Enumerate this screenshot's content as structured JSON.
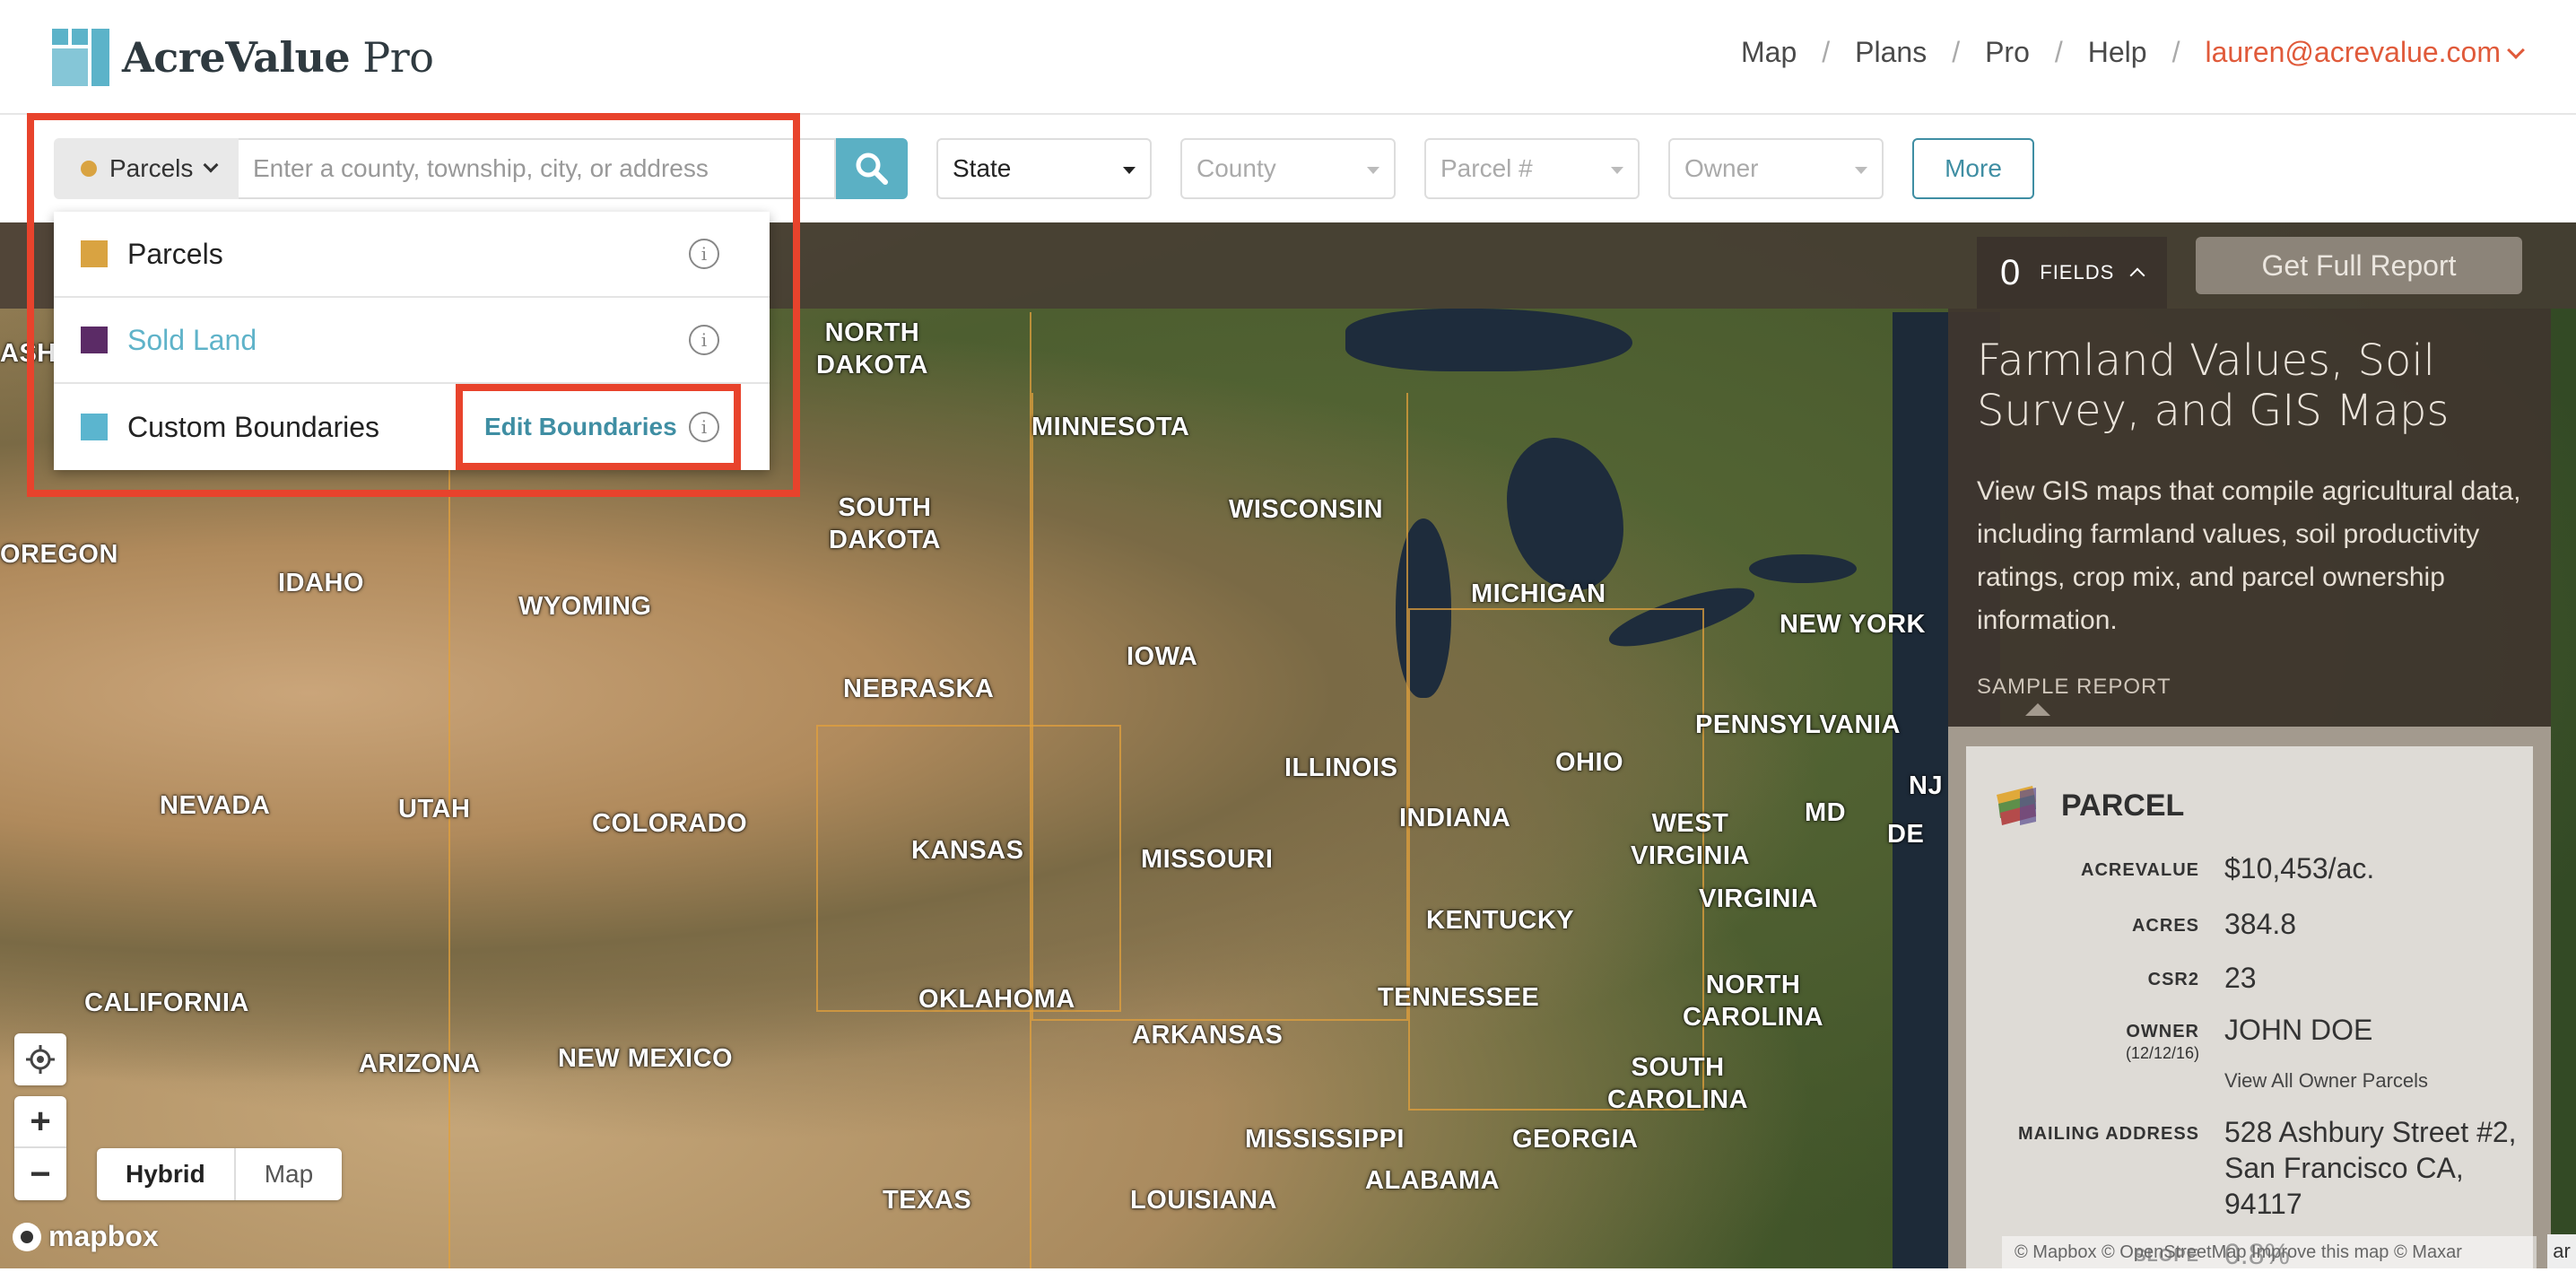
{
  "header": {
    "logo_bold": "AcreValue",
    "logo_light": "Pro",
    "nav": [
      "Map",
      "Plans",
      "Pro",
      "Help"
    ],
    "user_email": "lauren@acrevalue.com"
  },
  "filters": {
    "layer_label": "Parcels",
    "layer_dot_color": "#d9a341",
    "search_placeholder": "Enter a county, township, city, or address",
    "state_label": "State",
    "county_placeholder": "County",
    "parcel_placeholder": "Parcel #",
    "owner_placeholder": "Owner",
    "more_label": "More"
  },
  "layer_menu": {
    "items": [
      {
        "label": "Parcels",
        "color": "#d9a341"
      },
      {
        "label": "Sold Land",
        "color": "#5b2b66"
      },
      {
        "label": "Custom Boundaries",
        "color": "#5bb5cf"
      }
    ],
    "edit_label": "Edit Boundaries",
    "info_glyph": "i"
  },
  "map": {
    "state_labels": {
      "north_dakota": "NORTH\nDAKOTA",
      "minnesota": "MINNESOTA",
      "south_dakota": "SOUTH\nDAKOTA",
      "wisconsin": "WISCONSIN",
      "oregon": "OREGON",
      "idaho": "IDAHO",
      "wyoming": "WYOMING",
      "michigan": "MICHIGAN",
      "new_york": "NEW YORK",
      "iowa": "IOWA",
      "nebraska": "NEBRASKA",
      "pennsylvania": "PENNSYLVANIA",
      "illinois": "ILLINOIS",
      "ohio": "OHIO",
      "nevada": "NEVADA",
      "utah": "UTAH",
      "colorado": "COLORADO",
      "indiana": "INDIANA",
      "md": "MD",
      "nj": "NJ",
      "de": "DE",
      "kansas": "KANSAS",
      "missouri": "MISSOURI",
      "west_virginia": "WEST\nVIRGINIA",
      "virginia": "VIRGINIA",
      "kentucky": "KENTUCKY",
      "california": "CALIFORNIA",
      "oklahoma": "OKLAHOMA",
      "tennessee": "TENNESSEE",
      "north_carolina": "NORTH\nCAROLINA",
      "arizona": "ARIZONA",
      "new_mexico": "NEW MEXICO",
      "arkansas": "ARKANSAS",
      "south_carolina": "SOUTH\nCAROLINA",
      "mississippi": "MISSISSIPPI",
      "georgia": "GEORGIA",
      "alabama": "ALABAMA",
      "texas": "TEXAS",
      "louisiana": "LOUISIANA",
      "ash": "ASH"
    },
    "zoom_in": "+",
    "zoom_out": "−",
    "maptype_hybrid": "Hybrid",
    "maptype_map": "Map",
    "mapbox_label": "mapbox",
    "attribution": "© Mapbox © OpenStreetMap Improve this map © Maxar",
    "edge_badge": "ar"
  },
  "panel": {
    "fields_count": "0",
    "fields_label": "FIELDS",
    "report_button": "Get Full Report",
    "title": "Farmland Values, Soil Survey, and GIS Maps",
    "description": "View GIS maps that compile agricultural data, including farmland values, soil productivity ratings, crop mix, and parcel ownership information.",
    "sample_label": "SAMPLE REPORT",
    "card": {
      "heading": "PARCEL",
      "acrevalue_key": "ACREVALUE",
      "acrevalue_val": "$10,453/ac.",
      "acres_key": "ACRES",
      "acres_val": "384.8",
      "csr2_key": "CSR2",
      "csr2_val": "23",
      "owner_key": "OWNER",
      "owner_date": "(12/12/16)",
      "owner_val": "JOHN DOE",
      "owner_link": "View All Owner Parcels",
      "mailing_key": "MAILING ADDRESS",
      "mailing_val": "528 Ashbury Street #2, San Francisco CA, 94117",
      "slope_key": "SLOPE",
      "slope_val": "0.8%"
    }
  }
}
